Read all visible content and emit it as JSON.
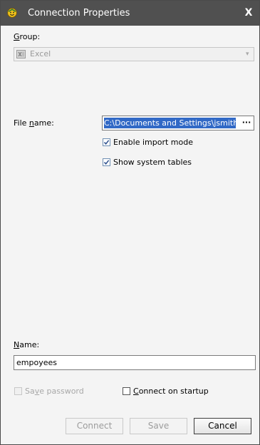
{
  "window": {
    "title": "Connection Properties",
    "close_glyph": "X",
    "app_icon": "smiley-app-icon"
  },
  "group": {
    "label_access_key": "G",
    "label_rest": "roup:",
    "value": "Excel",
    "value_icon": "excel-icon"
  },
  "file": {
    "label_pre": "File ",
    "label_access_key": "n",
    "label_post": "ame:",
    "value": "C:\\Documents and Settings\\jsmith\\",
    "browse_label": "···"
  },
  "options": {
    "enable_import_mode": {
      "label": "Enable import mode",
      "checked": true
    },
    "show_system_tables": {
      "label": "Show system tables",
      "checked": true
    }
  },
  "name": {
    "label_access_key": "N",
    "label_rest": "ame:",
    "value": "empoyees"
  },
  "save_password": {
    "label_pre": "Sa",
    "label_access_key": "v",
    "label_post": "e password",
    "checked": false,
    "enabled": false
  },
  "connect_on_startup": {
    "label_access_key": "C",
    "label_rest": "onnect on startup",
    "checked": false
  },
  "buttons": {
    "connect": "Connect",
    "save": "Save",
    "cancel": "Cancel"
  },
  "colors": {
    "titlebar": "#505050",
    "selection": "#3169c6",
    "checkbox_border": "#6f8fb3",
    "check_mark": "#2b4e8c"
  }
}
